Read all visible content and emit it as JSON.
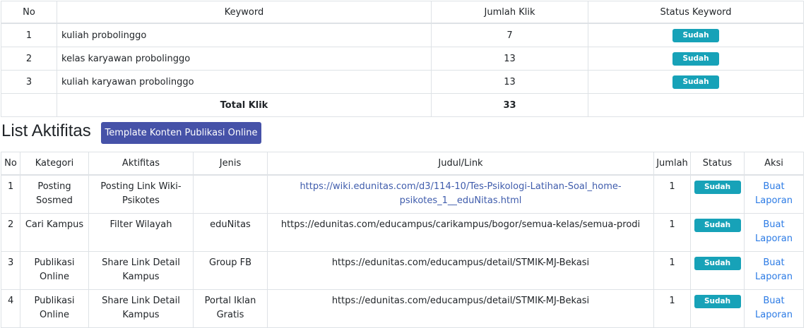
{
  "keyword_table": {
    "headers": [
      "No",
      "Keyword",
      "Jumlah Klik",
      "Status Keyword"
    ],
    "rows": [
      {
        "no": "1",
        "keyword": "kuliah probolinggo",
        "clicks": "7",
        "status": "Sudah"
      },
      {
        "no": "2",
        "keyword": "kelas karyawan probolinggo",
        "clicks": "13",
        "status": "Sudah"
      },
      {
        "no": "3",
        "keyword": "kuliah karyawan probolinggo",
        "clicks": "13",
        "status": "Sudah"
      }
    ],
    "total_label": "Total Klik",
    "total_value": "33"
  },
  "activities": {
    "title": "List Aktifitas",
    "template_button_label": "Template Konten Publikasi Online",
    "headers": [
      "No",
      "Kategori",
      "Aktifitas",
      "Jenis",
      "Judul/Link",
      "Jumlah",
      "Status",
      "Aksi"
    ],
    "rows": [
      {
        "no": "1",
        "kategori": "Posting Sosmed",
        "aktifitas": "Posting Link Wiki-Psikotes",
        "jenis": "",
        "link": "https://wiki.edunitas.com/d3/114-10/Tes-Psikologi-Latihan-Soal_home-psikotes_1__eduNitas.html",
        "jumlah": "1",
        "status": "Sudah",
        "aksi": "Buat Laporan"
      },
      {
        "no": "2",
        "kategori": "Cari Kampus",
        "aktifitas": "Filter Wilayah",
        "jenis": "eduNitas",
        "link": "https://edunitas.com/educampus/carikampus/bogor/semua-kelas/semua-prodi",
        "jumlah": "1",
        "status": "Sudah",
        "aksi": "Buat Laporan"
      },
      {
        "no": "3",
        "kategori": "Publikasi Online",
        "aktifitas": "Share Link Detail Kampus",
        "jenis": "Group FB",
        "link": "https://edunitas.com/educampus/detail/STMIK-MJ-Bekasi",
        "jumlah": "1",
        "status": "Sudah",
        "aksi": "Buat Laporan"
      },
      {
        "no": "4",
        "kategori": "Publikasi Online",
        "aktifitas": "Share Link Detail Kampus",
        "jenis": "Portal Iklan Gratis",
        "link": "https://edunitas.com/educampus/detail/STMIK-MJ-Bekasi",
        "jumlah": "1",
        "status": "Sudah",
        "aksi": "Buat Laporan"
      }
    ]
  },
  "colors": {
    "badge": "#17a2b8",
    "button": "#4652a8",
    "link": "#2c7be5"
  }
}
